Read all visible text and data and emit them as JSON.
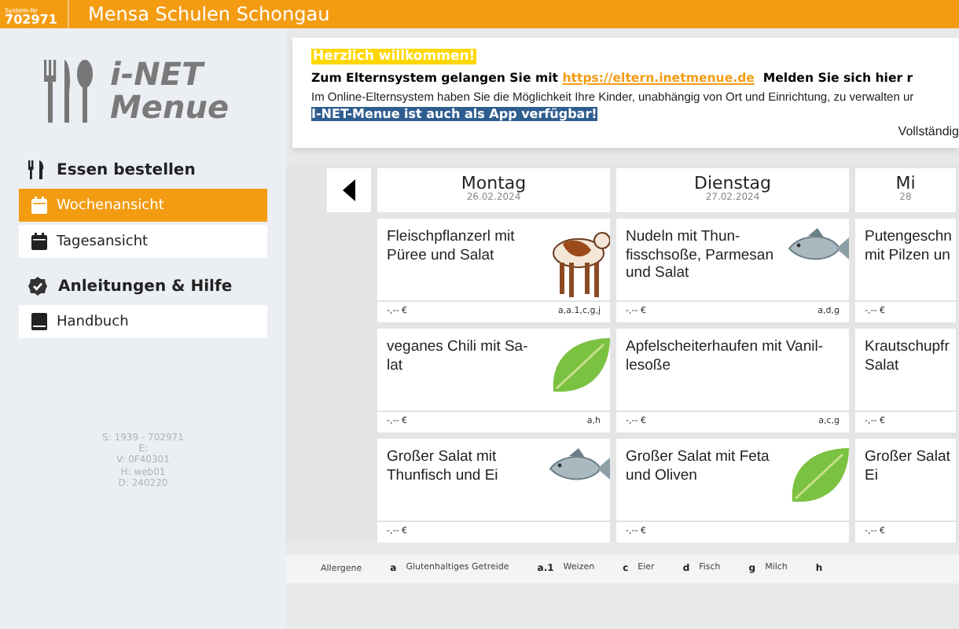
{
  "header": {
    "system_label": "System-Nr",
    "system_number": "702971",
    "title": "Mensa Schulen Schongau"
  },
  "logo": {
    "line1": "i-NET",
    "line2": "Menue"
  },
  "sidebar": {
    "sections": [
      {
        "title": "Essen bestellen",
        "items": [
          {
            "label": "Wochenansicht",
            "selected": true
          },
          {
            "label": "Tagesansicht",
            "selected": false
          }
        ]
      },
      {
        "title": "Anleitungen & Hilfe",
        "items": [
          {
            "label": "Handbuch",
            "selected": false
          }
        ]
      }
    ],
    "info": [
      "S: 1939 - 702971",
      "E:",
      "V: 0F40301",
      "H: web01",
      "D: 240220"
    ]
  },
  "welcome": {
    "heading": "Herzlich willkommen!",
    "intro": "Zum Elternsystem gelangen Sie mit",
    "link": "https://eltern.inetmenue.de",
    "login_text": "Melden Sie sich hier r",
    "description": "Im Online-Elternsystem haben Sie die Möglichkeit Ihre Kinder, unabhängig von Ort und Einrichtung, zu verwalten ur",
    "app_notice": "I-NET-Menue ist auch als App verfügbar!",
    "more": "Vollständig"
  },
  "days": [
    {
      "name": "Montag",
      "date": "26.02.2024",
      "meals": [
        {
          "name": "Fleischpflanzerl mit Püree und Salat",
          "kind": "cow",
          "price": "-,-- €",
          "allergens": "a,a.1,c,g,j"
        },
        {
          "name": "veganes Chili mit Sa-lat",
          "kind": "leaf",
          "price": "-,-- €",
          "allergens": "a,h"
        },
        {
          "name": "Großer Salat mit Thunfisch und Ei",
          "kind": "fish",
          "price": "-,-- €"
        }
      ]
    },
    {
      "name": "Dienstag",
      "date": "27.02.2024",
      "meals": [
        {
          "name": "Nudeln mit Thun-fisschsoße, Parmesan und Salat",
          "kind": "fish",
          "price": "-,-- €",
          "allergens": "a,d,g"
        },
        {
          "name": "Apfelscheiterhaufen mit Vanil-lesoße",
          "kind": "plain",
          "price": "-,-- €",
          "allergens": "a,c,g"
        },
        {
          "name": "Großer Salat mit Feta und Oliven",
          "kind": "leaf",
          "price": "-,-- €"
        }
      ]
    },
    {
      "name": "Mi",
      "date": "28",
      "meals": [
        {
          "name": "Putengeschn mit Pilzen un",
          "kind": "plain",
          "price": "-,-- €"
        },
        {
          "name": "Krautschupfr Salat",
          "kind": "plain",
          "price": "-,-- €"
        },
        {
          "name": "Großer Salat Ei",
          "kind": "plain",
          "price": "-,-- €"
        }
      ]
    }
  ],
  "legend": {
    "title": "Allergene",
    "items": [
      {
        "code": "a",
        "label": "Glutenhaltiges Getreide"
      },
      {
        "code": "a.1",
        "label": "Weizen"
      },
      {
        "code": "c",
        "label": "Eier"
      },
      {
        "code": "d",
        "label": "Fisch"
      },
      {
        "code": "g",
        "label": "Milch"
      },
      {
        "code": "h"
      }
    ]
  }
}
